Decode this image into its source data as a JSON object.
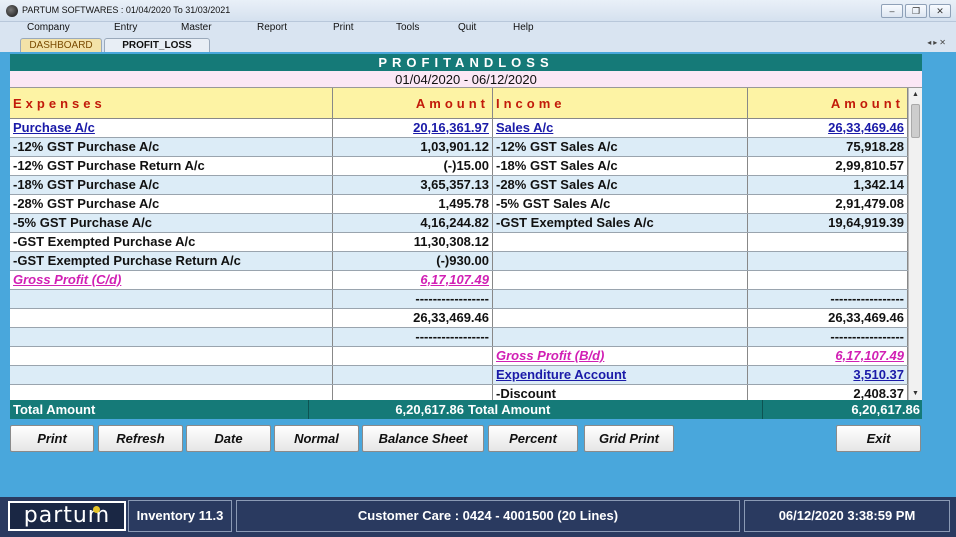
{
  "window": {
    "title": "PARTUM SOFTWARES : 01/04/2020 To 31/03/2021",
    "controls": [
      "minimize",
      "restore",
      "close"
    ]
  },
  "menu": [
    "Company",
    "Entry",
    "Master",
    "Report",
    "Print",
    "Tools",
    "Quit",
    "Help"
  ],
  "tabs": [
    {
      "label": "DASHBOARD",
      "active": false
    },
    {
      "label": "PROFIT_LOSS",
      "active": true
    }
  ],
  "report": {
    "title": "PROFITANDLOSS",
    "period": "01/04/2020 - 06/12/2020",
    "headers": {
      "expenses": "Expenses",
      "amount_left": "Amount",
      "income": "Income",
      "amount_right": "Amount"
    },
    "rows": [
      {
        "exp": "Purchase A/c",
        "exp_amt": "20,16,361.97",
        "inc": "Sales A/c",
        "inc_amt": "26,33,469.46",
        "exp_style": "link",
        "inc_style": "link"
      },
      {
        "exp": "-12% GST Purchase A/c",
        "exp_amt": "1,03,901.12",
        "inc": "-12% GST Sales A/c",
        "inc_amt": "75,918.28"
      },
      {
        "exp": "-12% GST Purchase Return A/c",
        "exp_amt": "(-)15.00",
        "inc": "-18% GST Sales A/c",
        "inc_amt": "2,99,810.57"
      },
      {
        "exp": "-18% GST Purchase A/c",
        "exp_amt": "3,65,357.13",
        "inc": "-28% GST Sales A/c",
        "inc_amt": "1,342.14"
      },
      {
        "exp": "-28% GST Purchase A/c",
        "exp_amt": "1,495.78",
        "inc": "-5% GST Sales A/c",
        "inc_amt": "2,91,479.08"
      },
      {
        "exp": "-5% GST Purchase A/c",
        "exp_amt": "4,16,244.82",
        "inc": "-GST Exempted Sales A/c",
        "inc_amt": "19,64,919.39"
      },
      {
        "exp": "-GST Exempted Purchase A/c",
        "exp_amt": "11,30,308.12",
        "inc": "",
        "inc_amt": ""
      },
      {
        "exp": "-GST Exempted Purchase Return A/c",
        "exp_amt": "(-)930.00",
        "inc": "",
        "inc_amt": ""
      },
      {
        "exp": "Gross Profit (C/d)",
        "exp_amt": "6,17,107.49",
        "inc": "",
        "inc_amt": "",
        "exp_style": "gross"
      },
      {
        "exp": "",
        "exp_amt": "-----------------",
        "inc": "",
        "inc_amt": "-----------------"
      },
      {
        "exp": "",
        "exp_amt": "26,33,469.46",
        "inc": "",
        "inc_amt": "26,33,469.46"
      },
      {
        "exp": "",
        "exp_amt": "-----------------",
        "inc": "",
        "inc_amt": "-----------------"
      },
      {
        "exp": "",
        "exp_amt": "",
        "inc": "Gross Profit (B/d)",
        "inc_amt": "6,17,107.49",
        "inc_style": "gross"
      },
      {
        "exp": "",
        "exp_amt": "",
        "inc": "Expenditure Account",
        "inc_amt": "3,510.37",
        "inc_style": "link"
      },
      {
        "exp": "",
        "exp_amt": "",
        "inc": "-Discount",
        "inc_amt": "2,408.37"
      }
    ],
    "totals": {
      "left_label": "Total Amount",
      "left_value": "6,20,617.86",
      "right_label": "Total Amount",
      "right_value": "6,20,617.86"
    }
  },
  "buttons": {
    "print": "Print",
    "refresh": "Refresh",
    "date": "Date",
    "normal": "Normal",
    "balance_sheet": "Balance Sheet",
    "percent": "Percent",
    "grid_print": "Grid Print",
    "exit": "Exit"
  },
  "footer": {
    "logo": "partum",
    "product": "Inventory 11.3",
    "customer_care": "Customer Care : 0424 - 4001500  (20 Lines)",
    "datetime": "06/12/2020 3:38:59 PM"
  },
  "colors": {
    "header_teal": "#157a78",
    "frame_blue": "#49a7dc",
    "column_header": "#fdf3a4",
    "column_text": "#c21a0a",
    "link": "#1a1aa8",
    "gross_profit": "#d11fb4",
    "footer": "#2a3a60"
  }
}
